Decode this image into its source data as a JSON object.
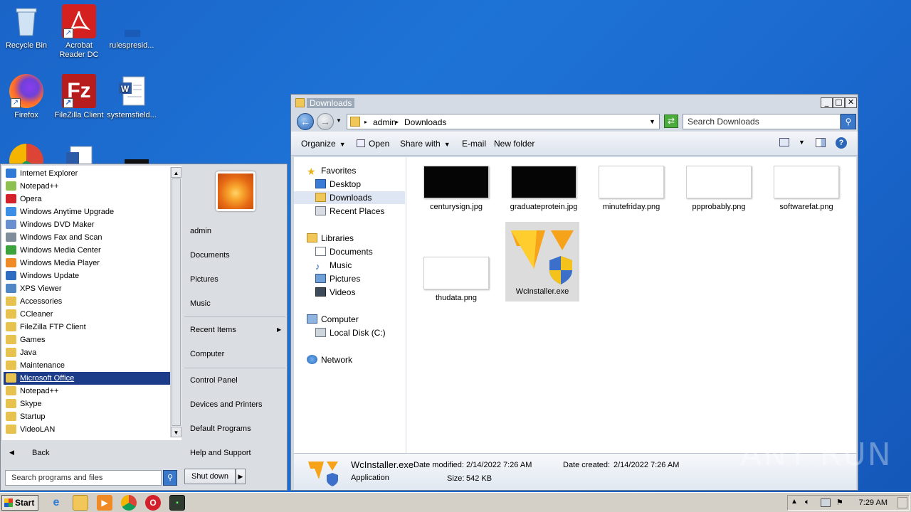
{
  "desktop": {
    "icons": [
      {
        "label": "Recycle Bin"
      },
      {
        "label": "Acrobat Reader DC"
      },
      {
        "label": "rulespresid..."
      },
      {
        "label": "Firefox"
      },
      {
        "label": "FileZilla Client"
      },
      {
        "label": "systemsfield..."
      }
    ]
  },
  "explorer": {
    "title": "Downloads",
    "breadcrumb": [
      "admin",
      "Downloads"
    ],
    "search_placeholder": "Search Downloads",
    "toolbar": {
      "organize": "Organize",
      "open": "Open",
      "share_with": "Share with",
      "email": "E-mail",
      "new_folder": "New folder"
    },
    "nav": {
      "favorites": "Favorites",
      "desktop": "Desktop",
      "downloads": "Downloads",
      "recent_places": "Recent Places",
      "libraries": "Libraries",
      "documents": "Documents",
      "music": "Music",
      "pictures": "Pictures",
      "videos": "Videos",
      "computer": "Computer",
      "local_disk": "Local Disk (C:)",
      "network": "Network"
    },
    "files": [
      {
        "name": "centurysign.jpg"
      },
      {
        "name": "graduateprotein.jpg"
      },
      {
        "name": "minutefriday.png"
      },
      {
        "name": "ppprobably.png"
      },
      {
        "name": "softwarefat.png"
      },
      {
        "name": "thudata.png"
      },
      {
        "name": "WcInstaller.exe"
      }
    ],
    "details": {
      "name": "WcInstaller.exe",
      "type": "Application",
      "date_modified_label": "Date modified:",
      "date_modified": "2/14/2022 7:26 AM",
      "date_created_label": "Date created:",
      "date_created": "2/14/2022 7:26 AM",
      "size_label": "Size:",
      "size": "542 KB"
    }
  },
  "startmenu": {
    "programs": [
      {
        "label": "Internet Explorer",
        "color": "#2f7ad6"
      },
      {
        "label": "Notepad++",
        "color": "#8cc152"
      },
      {
        "label": "Opera",
        "color": "#d3202a"
      },
      {
        "label": "Windows Anytime Upgrade",
        "color": "#3a8ee6"
      },
      {
        "label": "Windows DVD Maker",
        "color": "#6a8fcf"
      },
      {
        "label": "Windows Fax and Scan",
        "color": "#7f8c9a"
      },
      {
        "label": "Windows Media Center",
        "color": "#3ca33c"
      },
      {
        "label": "Windows Media Player",
        "color": "#f08a24"
      },
      {
        "label": "Windows Update",
        "color": "#2d6cc0"
      },
      {
        "label": "XPS Viewer",
        "color": "#4f86c6"
      },
      {
        "label": "Accessories",
        "color": "#e8c24f"
      },
      {
        "label": "CCleaner",
        "color": "#e8c24f"
      },
      {
        "label": "FileZilla FTP Client",
        "color": "#e8c24f"
      },
      {
        "label": "Games",
        "color": "#e8c24f"
      },
      {
        "label": "Java",
        "color": "#e8c24f"
      },
      {
        "label": "Maintenance",
        "color": "#e8c24f"
      },
      {
        "label": "Microsoft Office",
        "color": "#e8c24f"
      },
      {
        "label": "Notepad++",
        "color": "#e8c24f"
      },
      {
        "label": "Skype",
        "color": "#e8c24f"
      },
      {
        "label": "Startup",
        "color": "#e8c24f"
      },
      {
        "label": "VideoLAN",
        "color": "#e8c24f"
      }
    ],
    "back": "Back",
    "search_placeholder": "Search programs and files",
    "right": {
      "user": "admin",
      "documents": "Documents",
      "pictures": "Pictures",
      "music": "Music",
      "recent_items": "Recent Items",
      "computer": "Computer",
      "control_panel": "Control Panel",
      "devices_printers": "Devices and Printers",
      "default_programs": "Default Programs",
      "help_support": "Help and Support"
    },
    "shutdown": "Shut down"
  },
  "taskbar": {
    "start": "Start",
    "clock": "7:29 AM"
  },
  "watermark": "ANY RUN"
}
